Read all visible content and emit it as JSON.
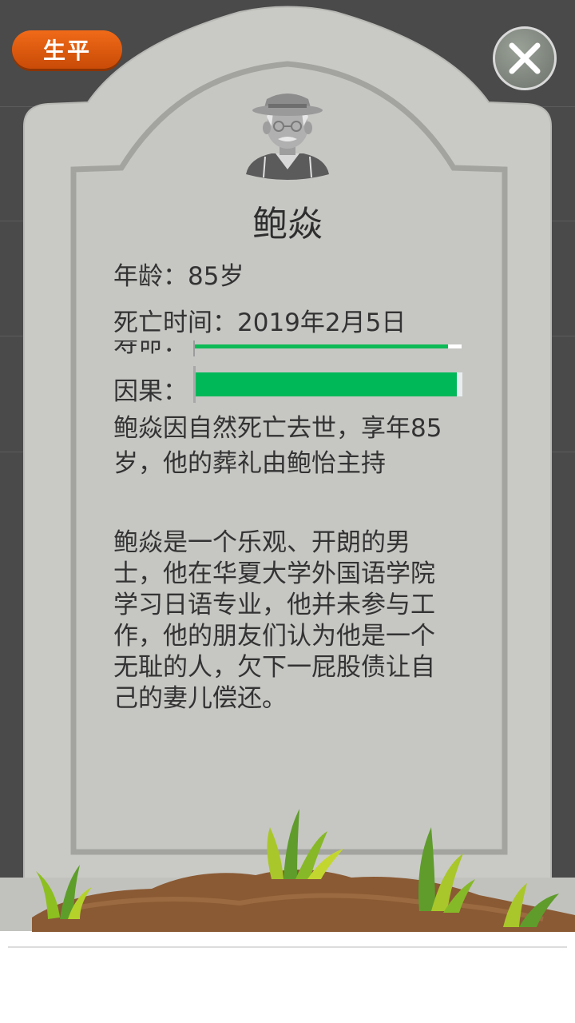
{
  "header": {
    "life_button_label": "生平",
    "close_icon": "close-icon"
  },
  "deceased": {
    "name": "鲍焱",
    "age_label": "年龄：",
    "age_value": "85岁",
    "death_label": "死亡时间：",
    "death_value": "2019年2月5日"
  },
  "bars": {
    "partial_label": "寿命：",
    "partial_value": 0.95,
    "karma_label": "因果：",
    "karma_value": 0.98
  },
  "text": {
    "summary": "鲍焱因自然死亡去世，享年85岁，他的葬礼由鲍怡主持",
    "bio": "鲍焱是一个乐观、开朗的男士，他在华夏大学外国语学院学习日语专业，他并未参与工作，他的朋友们认为他是一个无耻的人，欠下一屁股债让自己的妻儿偿还。"
  },
  "colors": {
    "stone": "#c9cac6",
    "bar_fill": "#00b858",
    "button": "#e05a10"
  }
}
